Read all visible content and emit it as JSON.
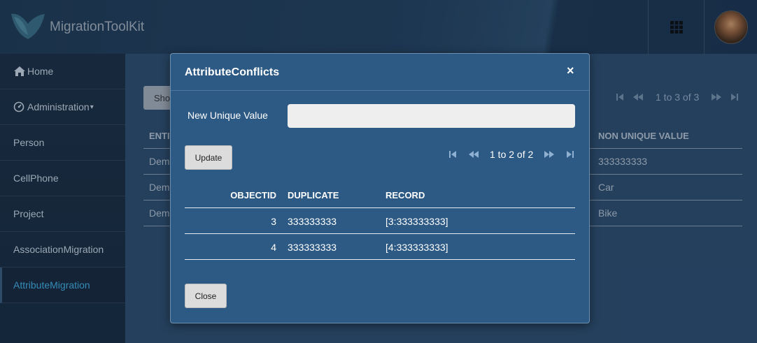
{
  "header": {
    "app_title": "MigrationToolKit",
    "logo_icon": "leaf-logo-icon",
    "grid_icon": "apps-grid-icon"
  },
  "sidebar": {
    "items": [
      {
        "label": "Home",
        "icon": "home-icon"
      },
      {
        "label": "Administration",
        "icon": "gauge-icon",
        "caret": "▾"
      },
      {
        "label": "Person"
      },
      {
        "label": "CellPhone"
      },
      {
        "label": "Project"
      },
      {
        "label": "AssociationMigration"
      },
      {
        "label": "AttributeMigration",
        "active": true
      }
    ]
  },
  "background": {
    "show_button": "Show",
    "pager_text": "1 to 3 of 3",
    "columns": [
      "ENTITY",
      "NON UNIQUE VALUE"
    ],
    "rows": [
      [
        "Demo",
        "333333333"
      ],
      [
        "Demo",
        "Car"
      ],
      [
        "Demo",
        "Bike"
      ]
    ]
  },
  "modal": {
    "title": "AttributeConflicts",
    "close_x": "×",
    "field_label": "New Unique Value",
    "field_value": "",
    "update_button": "Update",
    "close_button": "Close",
    "pager_text": "1 to 2 of 2",
    "columns": [
      "OBJECTID",
      "DUPLICATE",
      "RECORD"
    ],
    "rows": [
      {
        "objectid": "3",
        "duplicate": "333333333",
        "record": "[3:333333333]"
      },
      {
        "objectid": "4",
        "duplicate": "333333333",
        "record": "[4:333333333]"
      }
    ]
  },
  "colors": {
    "modal_bg": "#2d5a85",
    "active_nav": "#3fa7d9",
    "sidebar_bg": "#1a2c42"
  }
}
